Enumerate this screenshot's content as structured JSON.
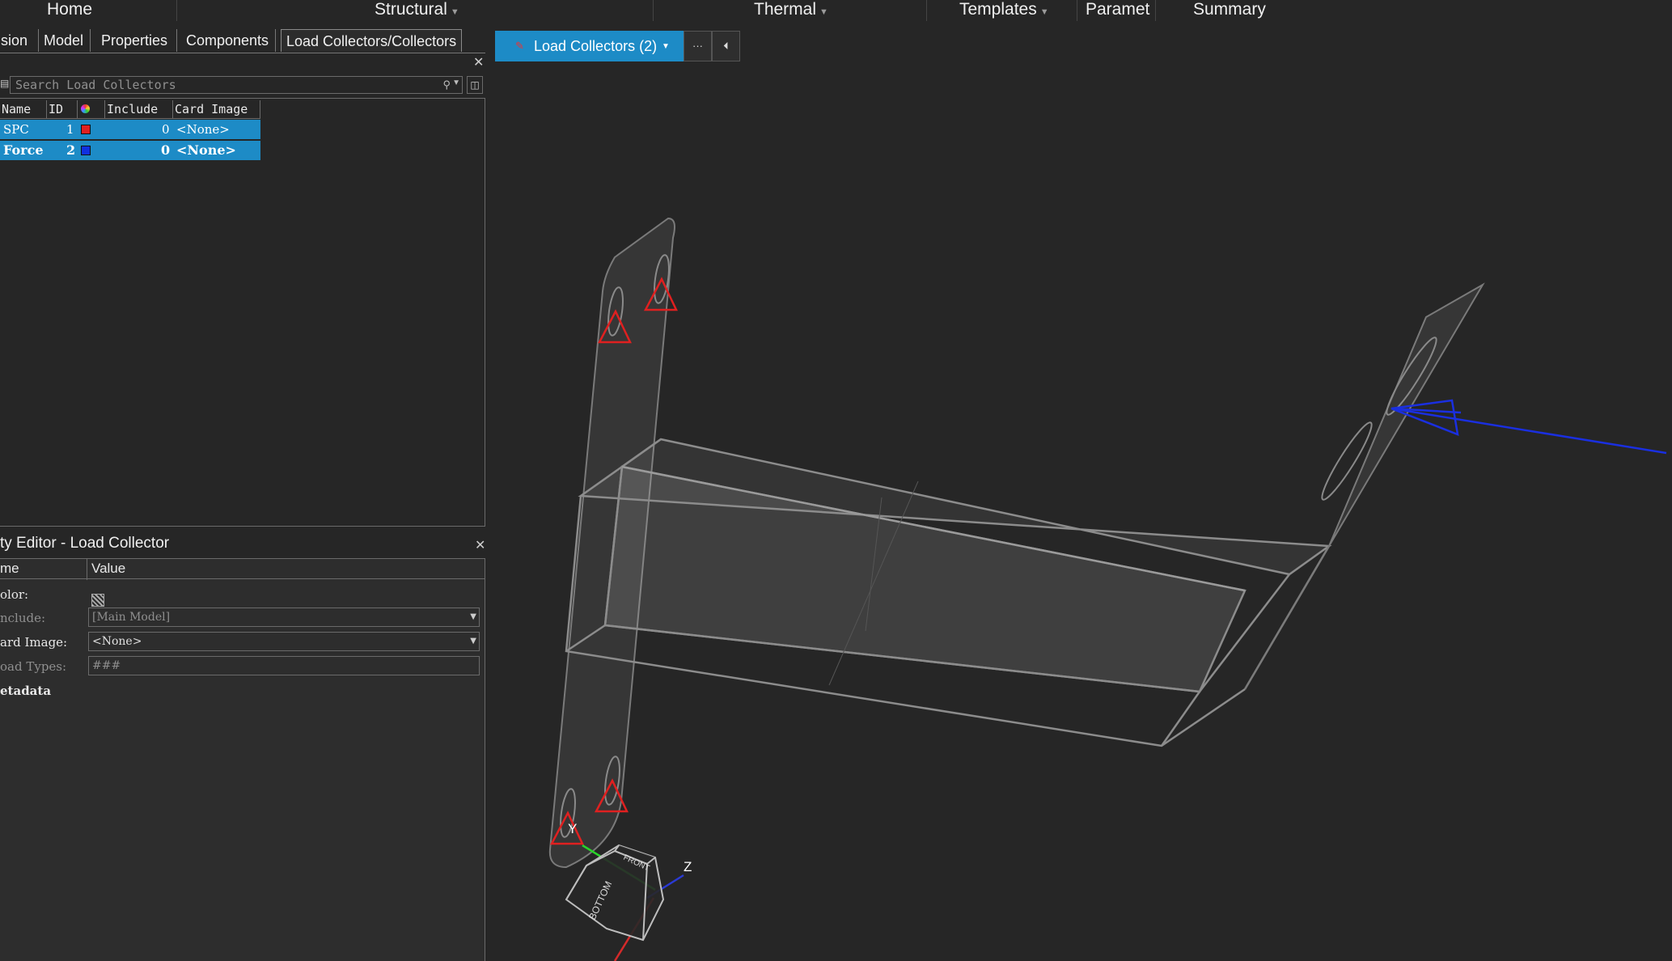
{
  "ribbon": {
    "tabs": [
      {
        "label": "Home",
        "has_arrow": false
      },
      {
        "label": "Structural",
        "has_arrow": true
      },
      {
        "label": "Thermal",
        "has_arrow": true
      },
      {
        "label": "Templates",
        "has_arrow": true
      },
      {
        "label": "Paramete",
        "has_arrow": false
      },
      {
        "label": "Summary",
        "has_arrow": false
      }
    ]
  },
  "panel_tabs": [
    "sion",
    "Model",
    "Properties",
    "Components",
    "Load Collectors/Collectors"
  ],
  "search": {
    "placeholder": "Search Load Collectors"
  },
  "table": {
    "columns": [
      "Name",
      "ID",
      "",
      "Include",
      "Card Image"
    ],
    "rows": [
      {
        "name": "SPC",
        "id": "1",
        "color": "#e02020",
        "include": "0",
        "card": "<None>"
      },
      {
        "name": "Force",
        "id": "2",
        "color": "#1030e0",
        "include": "0",
        "card": "<None>"
      }
    ]
  },
  "editor": {
    "title": "ty Editor - Load Collector",
    "columns": [
      "me",
      "Value"
    ],
    "props": [
      {
        "label": "olor:",
        "value": ""
      },
      {
        "label": "nclude:",
        "value": "[Main Model]"
      },
      {
        "label": "ard Image:",
        "value": "<None>"
      },
      {
        "label": "oad Types:",
        "value": "###"
      },
      {
        "label": "etadata",
        "value": ""
      }
    ]
  },
  "viewport": {
    "collector_button": "Load Collectors (2)",
    "more_glyph": "···",
    "collapse_glyph": "⏴",
    "axis_labels": {
      "y": "Y",
      "z": "Z"
    },
    "viewcube": {
      "front": "FRONT",
      "bottom": "BOTTOM"
    }
  },
  "colors": {
    "accent": "#1d8bc6",
    "spc": "#e02020",
    "force": "#1030e0"
  }
}
